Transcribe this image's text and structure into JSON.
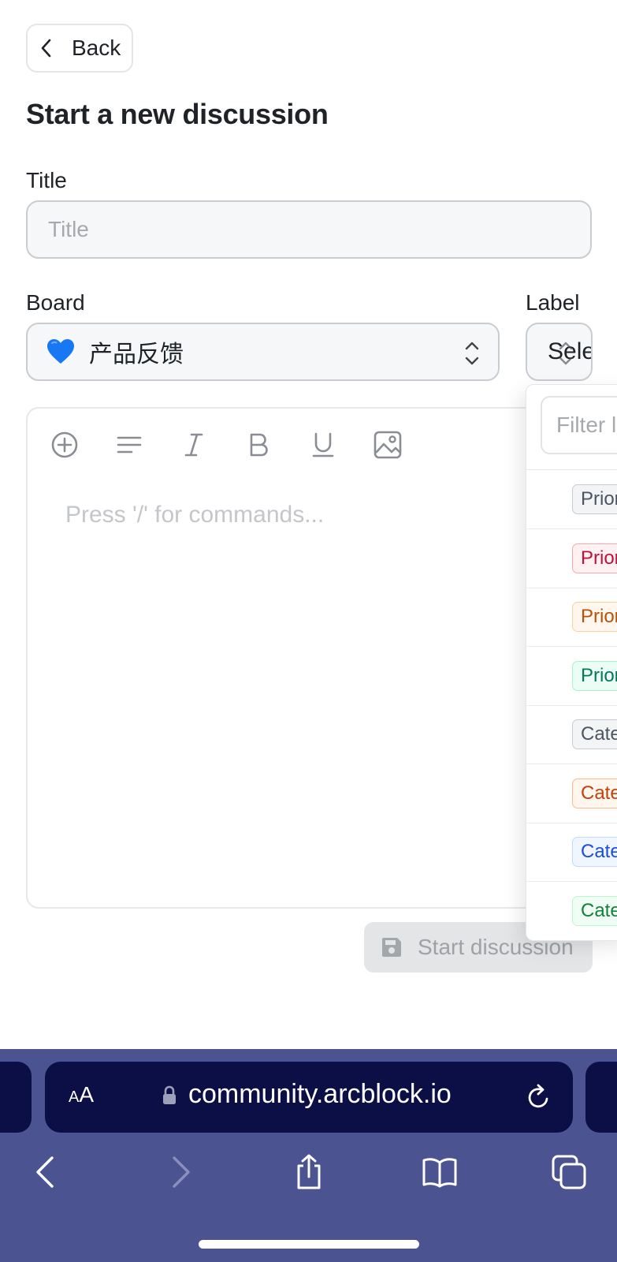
{
  "back_button": {
    "label": "Back"
  },
  "page_title": "Start a new discussion",
  "title_field": {
    "label": "Title",
    "placeholder": "Title"
  },
  "board_field": {
    "label": "Board",
    "value": "产品反馈"
  },
  "label_field": {
    "label": "Label",
    "value": "Sele"
  },
  "editor": {
    "placeholder": "Press '/' for commands..."
  },
  "submit_button": {
    "label": "Start discussion"
  },
  "label_popup": {
    "filter_placeholder": "Filter l",
    "items": [
      {
        "text": "Prior",
        "color": "#4b5563",
        "bg": "#f3f4f6",
        "border": "#c7cbd1"
      },
      {
        "text": "Prior",
        "color": "#be123c",
        "bg": "#fff1f2",
        "border": "#fda4af"
      },
      {
        "text": "Prior",
        "color": "#b45309",
        "bg": "#fff7ed",
        "border": "#fcd29a"
      },
      {
        "text": "Prior",
        "color": "#047857",
        "bg": "#ecfdf5",
        "border": "#a7f3d0"
      },
      {
        "text": "Cate",
        "color": "#4b5563",
        "bg": "#f3f4f6",
        "border": "#c7cbd1"
      },
      {
        "text": "Cate",
        "color": "#c2410c",
        "bg": "#fff7ed",
        "border": "#fdba8c"
      },
      {
        "text": "Cate",
        "color": "#1d4ed8",
        "bg": "#eff6ff",
        "border": "#bfdbfe"
      },
      {
        "text": "Cate",
        "color": "#15803d",
        "bg": "#f0fdf4",
        "border": "#bbf7d0"
      }
    ]
  },
  "browser": {
    "aa_label": "AA",
    "url": "community.arcblock.io"
  },
  "colors": {
    "browser_chrome": "#4b5391",
    "url_bar": "#0b0f46"
  }
}
